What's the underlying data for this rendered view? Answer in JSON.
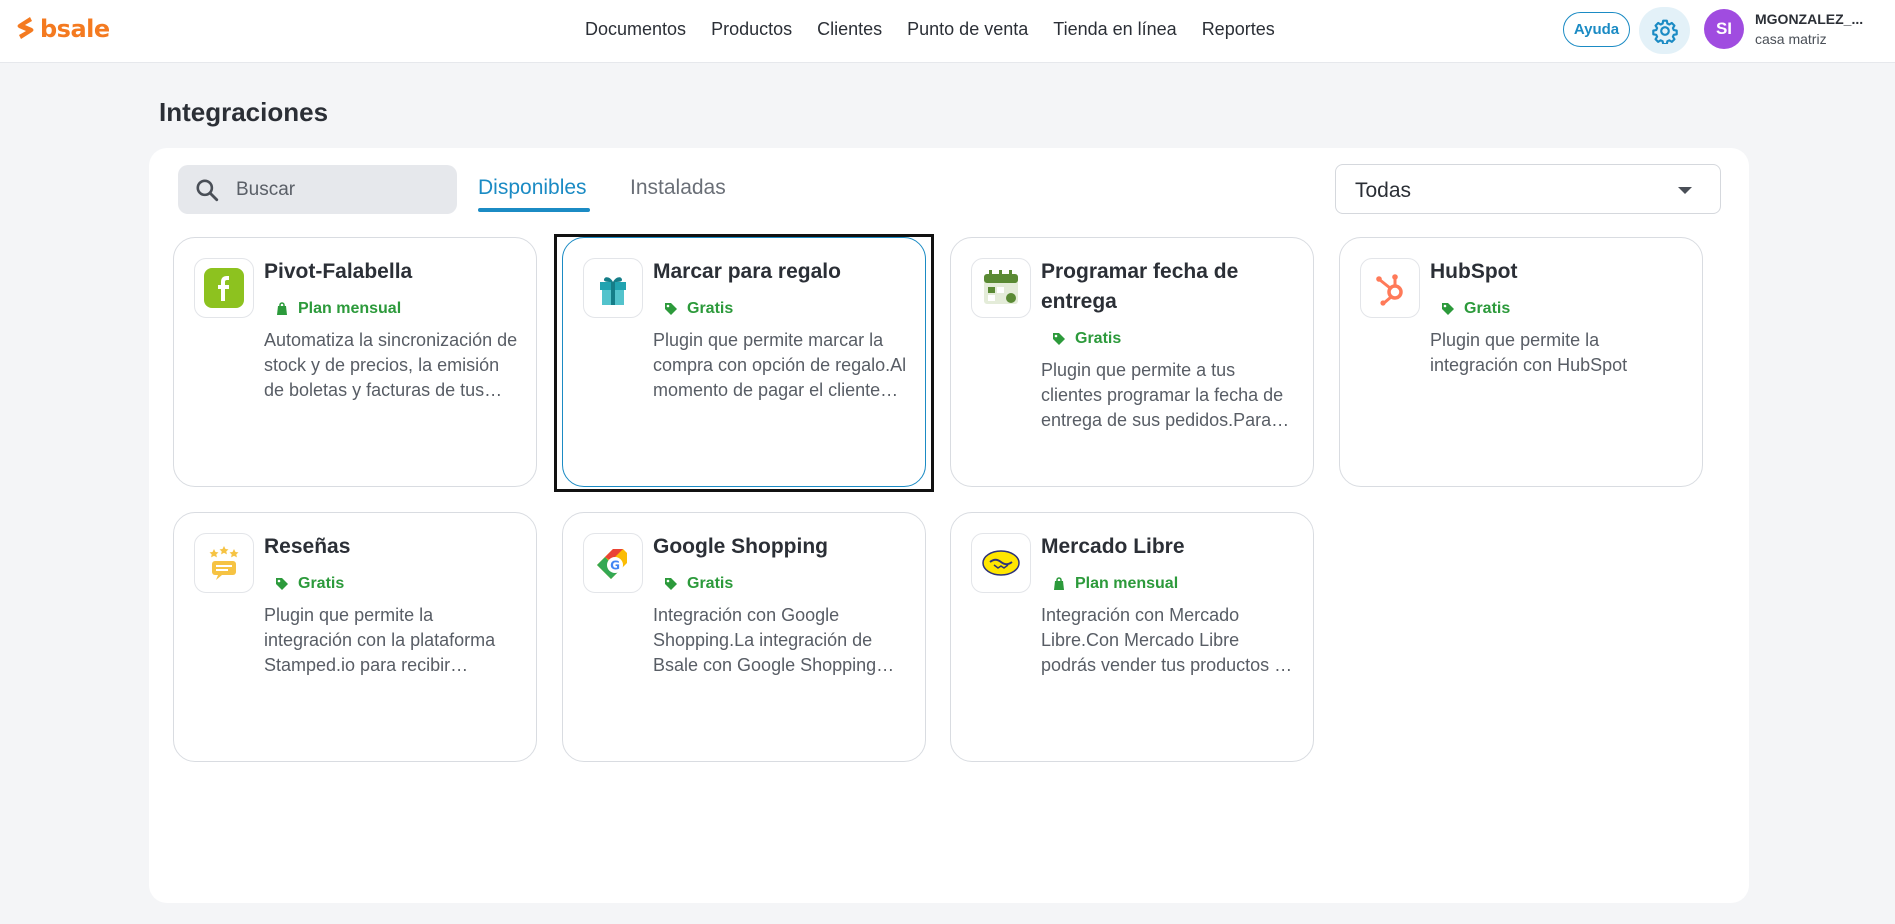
{
  "brand": {
    "name": "bsale",
    "color": "#f47a20"
  },
  "nav": {
    "items": [
      "Documentos",
      "Productos",
      "Clientes",
      "Punto de venta",
      "Tienda en línea",
      "Reportes"
    ]
  },
  "header": {
    "help_label": "Ayuda",
    "avatar_initials": "SI",
    "user_name": "MGONZALEZ_...",
    "branch": "casa matriz"
  },
  "page": {
    "title": "Integraciones"
  },
  "search": {
    "placeholder": "Buscar"
  },
  "tabs": [
    {
      "label": "Disponibles",
      "active": true
    },
    {
      "label": "Instaladas",
      "active": false
    }
  ],
  "filter": {
    "selected": "Todas"
  },
  "cards": [
    {
      "title": "Pivot-Falabella",
      "price": "Plan mensual",
      "price_icon": "bag-icon",
      "logo": "falabella-logo",
      "desc": "Automatiza la sincronización de stock y de precios, la emisión de boletas y facturas de tus ventas."
    },
    {
      "title": "Marcar para regalo",
      "price": "Gratis",
      "price_icon": "tag-icon",
      "logo": "gift-logo",
      "desc": "Plugin que permite marcar la compra con opción de regalo.Al momento de pagar el cliente podrá elegirlo."
    },
    {
      "title": "Programar fecha de entrega",
      "price": "Gratis",
      "price_icon": "tag-icon",
      "logo": "calendar-logo",
      "desc": "Plugin que permite a tus clientes programar la fecha de entrega de sus pedidos.Para configurarlo."
    },
    {
      "title": "HubSpot",
      "price": "Gratis",
      "price_icon": "tag-icon",
      "logo": "hubspot-logo",
      "desc": "Plugin que permite la integración con HubSpot"
    },
    {
      "title": "Reseñas",
      "price": "Gratis",
      "price_icon": "tag-icon",
      "logo": "reviews-logo",
      "desc": "Plugin que permite la integración con la plataforma Stamped.io para recibir reseñas."
    },
    {
      "title": "Google Shopping",
      "price": "Gratis",
      "price_icon": "tag-icon",
      "logo": "google-shopping-logo",
      "desc": "Integración con Google Shopping.La integración de Bsale con Google Shopping permite publicar."
    },
    {
      "title": "Mercado Libre",
      "price": "Plan mensual",
      "price_icon": "bag-icon",
      "logo": "mercadolibre-logo",
      "desc": "Integración con Mercado Libre.Con Mercado Libre podrás vender tus productos en línea."
    }
  ],
  "colors": {
    "accent": "#1b8bc4",
    "price_green": "#2c9a3b",
    "avatar": "#a04ce0"
  }
}
